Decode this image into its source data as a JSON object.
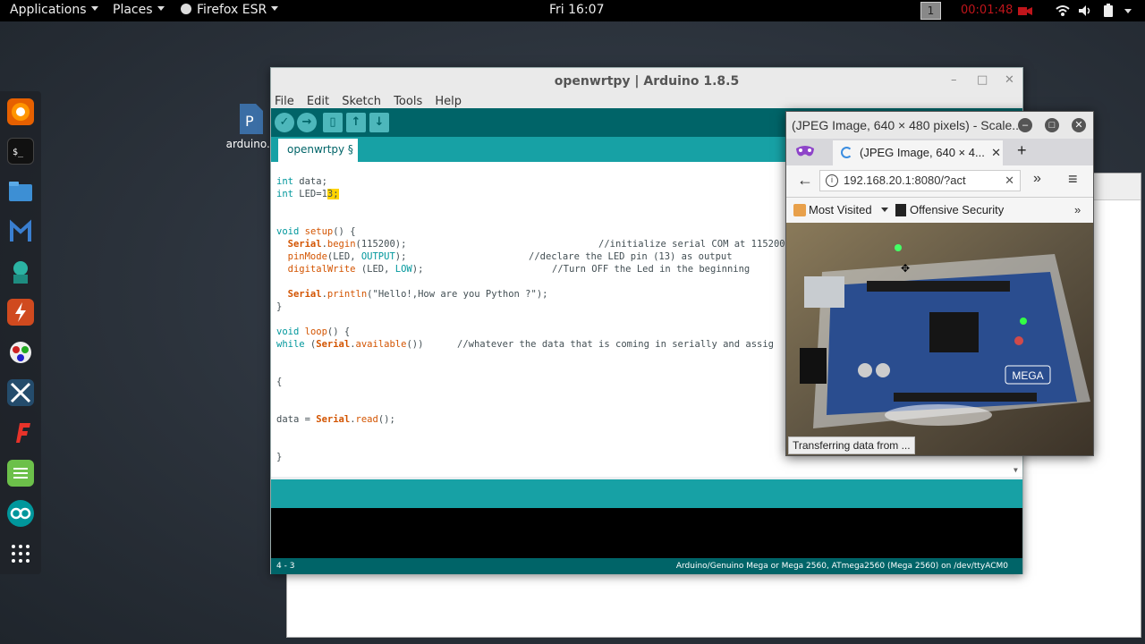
{
  "topbar": {
    "applications": "Applications",
    "places": "Places",
    "firefox": "Firefox ESR",
    "clock": "Fri 16:07",
    "workspace": "1",
    "recording_time": "00:01:48"
  },
  "desktop": {
    "icon_label": "arduino.p"
  },
  "arduino": {
    "title": "openwrtpy | Arduino 1.8.5",
    "menu": [
      "File",
      "Edit",
      "Sketch",
      "Tools",
      "Help"
    ],
    "tab_label": "openwrtpy §",
    "code": {
      "l1_kw": "int",
      "l1_rest": " data;",
      "l2_kw": "int",
      "l2_rest": " LED=1",
      "l2_hl": "3;",
      "l3_kw": "void",
      "l3_fn": " setup",
      "l3_rest": "() {",
      "l4_fn": "  Serial",
      "l4_dot": ".",
      "l4_fn2": "begin",
      "l4_rest": "(115200);",
      "l4_cm": "//initialize serial COM at 115200",
      "l5_fn": "  pinMode",
      "l5_rest1": "(LED, ",
      "l5_kw": "OUTPUT",
      "l5_rest2": ");",
      "l5_cm": "//declare the LED pin (13) as output",
      "l6_fn": "  digitalWrite",
      "l6_rest1": " (LED, ",
      "l6_kw": "LOW",
      "l6_rest2": ");",
      "l6_cm": "//Turn OFF the Led in the beginning",
      "l7_fn": "  Serial",
      "l7_dot": ".",
      "l7_fn2": "println",
      "l7_rest": "(\"Hello!,How are you Python ?\");",
      "l8": "}",
      "l9_kw": "void",
      "l9_fn": " loop",
      "l9_rest": "() {",
      "l10_kw": "while",
      "l10_rest1": " (",
      "l10_fn": "Serial",
      "l10_dot": ".",
      "l10_fn2": "available",
      "l10_rest2": "())",
      "l10_cm": "//whatever the data that is coming in serially and assig",
      "l11": "{",
      "l12_a": "data = ",
      "l12_fn": "Serial",
      "l12_dot": ".",
      "l12_fn2": "read",
      "l12_b": "();",
      "l13": "}"
    },
    "cursor_pos": "4 - 3",
    "board": "Arduino/Genuino Mega or Mega 2560, ATmega2560 (Mega 2560) on /dev/ttyACM0"
  },
  "firefox": {
    "title": "(JPEG Image, 640 × 480 pixels) - Scale...",
    "tab_title": "(JPEG Image, 640 × 4...",
    "url": "192.168.20.1:8080/?act",
    "bookmark_1": "Most Visited",
    "bookmark_2": "Offensive Security",
    "status": "Transferring data from ...",
    "board_label": "MEGA"
  }
}
